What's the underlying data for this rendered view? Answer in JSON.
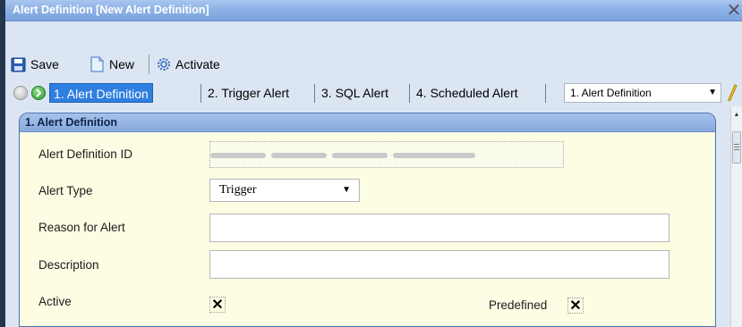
{
  "window": {
    "title": "Alert Definition [New Alert Definition]",
    "close_glyph": "✕"
  },
  "toolbar": {
    "save_label": "Save",
    "new_label": "New",
    "activate_label": "Activate",
    "icons": [
      "save-icon",
      "new-document-icon",
      "gear-icon"
    ]
  },
  "nav": {
    "tabs": [
      {
        "label": "1. Alert Definition",
        "active": true
      },
      {
        "label": "2. Trigger Alert",
        "active": false
      },
      {
        "label": "3. SQL Alert",
        "active": false
      },
      {
        "label": "4. Scheduled Alert",
        "active": false
      }
    ],
    "selector_value": "1. Alert Definition",
    "icons": [
      "back-arrow-icon",
      "forward-arrow-icon",
      "pencil-icon"
    ]
  },
  "panel": {
    "header": "1. Alert Definition",
    "fields": {
      "alert_definition_id_label": "Alert Definition ID",
      "alert_type_label": "Alert Type",
      "alert_type_value": "Trigger",
      "reason_label": "Reason for Alert",
      "reason_value": "",
      "description_label": "Description",
      "description_value": "",
      "active_label": "Active",
      "active_mark": "✕",
      "predefined_label": "Predefined",
      "predefined_mark": "✕"
    }
  },
  "colors": {
    "title_bar": "#8eb2e6",
    "active_tab": "#2f7fe0",
    "panel_bg": "#fdfde3",
    "panel_border": "#4f73b1"
  }
}
